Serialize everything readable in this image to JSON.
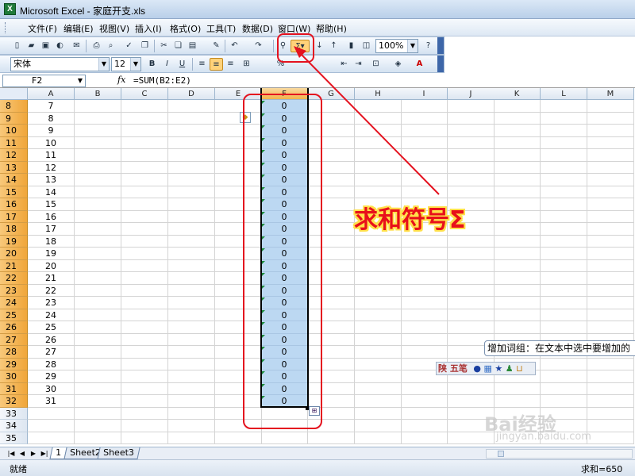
{
  "title_bar": {
    "title": "Microsoft Excel - 家庭开支.xls"
  },
  "menu": [
    "文件(F)",
    "编辑(E)",
    "视图(V)",
    "插入(I)",
    "格式(O)",
    "工具(T)",
    "数据(D)",
    "窗口(W)",
    "帮助(H)"
  ],
  "toolbar": {
    "zoom": "100%"
  },
  "format_toolbar": {
    "font": "宋体",
    "font_size": "12",
    "bold": "B",
    "italic": "I",
    "underline": "U",
    "percent": "%"
  },
  "formula_bar": {
    "name_box": "F2",
    "fx": "fx",
    "formula": "=SUM(B2:E2)"
  },
  "columns": [
    "A",
    "B",
    "C",
    "D",
    "E",
    "F",
    "G",
    "H",
    "I",
    "J",
    "K",
    "L",
    "M"
  ],
  "rows": [
    {
      "num": "8",
      "a": "7",
      "f": "0"
    },
    {
      "num": "9",
      "a": "8",
      "f": "0"
    },
    {
      "num": "10",
      "a": "9",
      "f": "0"
    },
    {
      "num": "11",
      "a": "10",
      "f": "0"
    },
    {
      "num": "12",
      "a": "11",
      "f": "0"
    },
    {
      "num": "13",
      "a": "12",
      "f": "0"
    },
    {
      "num": "14",
      "a": "13",
      "f": "0"
    },
    {
      "num": "15",
      "a": "14",
      "f": "0"
    },
    {
      "num": "16",
      "a": "15",
      "f": "0"
    },
    {
      "num": "17",
      "a": "16",
      "f": "0"
    },
    {
      "num": "18",
      "a": "17",
      "f": "0"
    },
    {
      "num": "19",
      "a": "18",
      "f": "0"
    },
    {
      "num": "20",
      "a": "19",
      "f": "0"
    },
    {
      "num": "21",
      "a": "20",
      "f": "0"
    },
    {
      "num": "22",
      "a": "21",
      "f": "0"
    },
    {
      "num": "23",
      "a": "22",
      "f": "0"
    },
    {
      "num": "24",
      "a": "23",
      "f": "0"
    },
    {
      "num": "25",
      "a": "24",
      "f": "0"
    },
    {
      "num": "26",
      "a": "25",
      "f": "0"
    },
    {
      "num": "27",
      "a": "26",
      "f": "0"
    },
    {
      "num": "28",
      "a": "27",
      "f": "0"
    },
    {
      "num": "29",
      "a": "28",
      "f": "0"
    },
    {
      "num": "30",
      "a": "29",
      "f": "0"
    },
    {
      "num": "31",
      "a": "30",
      "f": "0"
    },
    {
      "num": "32",
      "a": "31",
      "f": "0"
    },
    {
      "num": "33",
      "a": "",
      "f": ""
    },
    {
      "num": "34",
      "a": "",
      "f": ""
    },
    {
      "num": "35",
      "a": "",
      "f": ""
    }
  ],
  "annotation": {
    "label": "求和符号Σ",
    "color": "#e4121f"
  },
  "ime": {
    "tooltip": "增加词组：在文本中选中要增加的",
    "chars": "陕 五笔"
  },
  "sheet_tabs": [
    "1",
    "Sheet2",
    "Sheet3"
  ],
  "status": {
    "ready": "就绪",
    "sum": "求和=650"
  },
  "watermark": {
    "brand": "Bai经验",
    "url": "jingyan.baidu.com"
  },
  "accent_colors": {
    "selection": "#bcd8f2",
    "row_header_active": "#f0a63a",
    "annotation_red": "#e4121f"
  }
}
